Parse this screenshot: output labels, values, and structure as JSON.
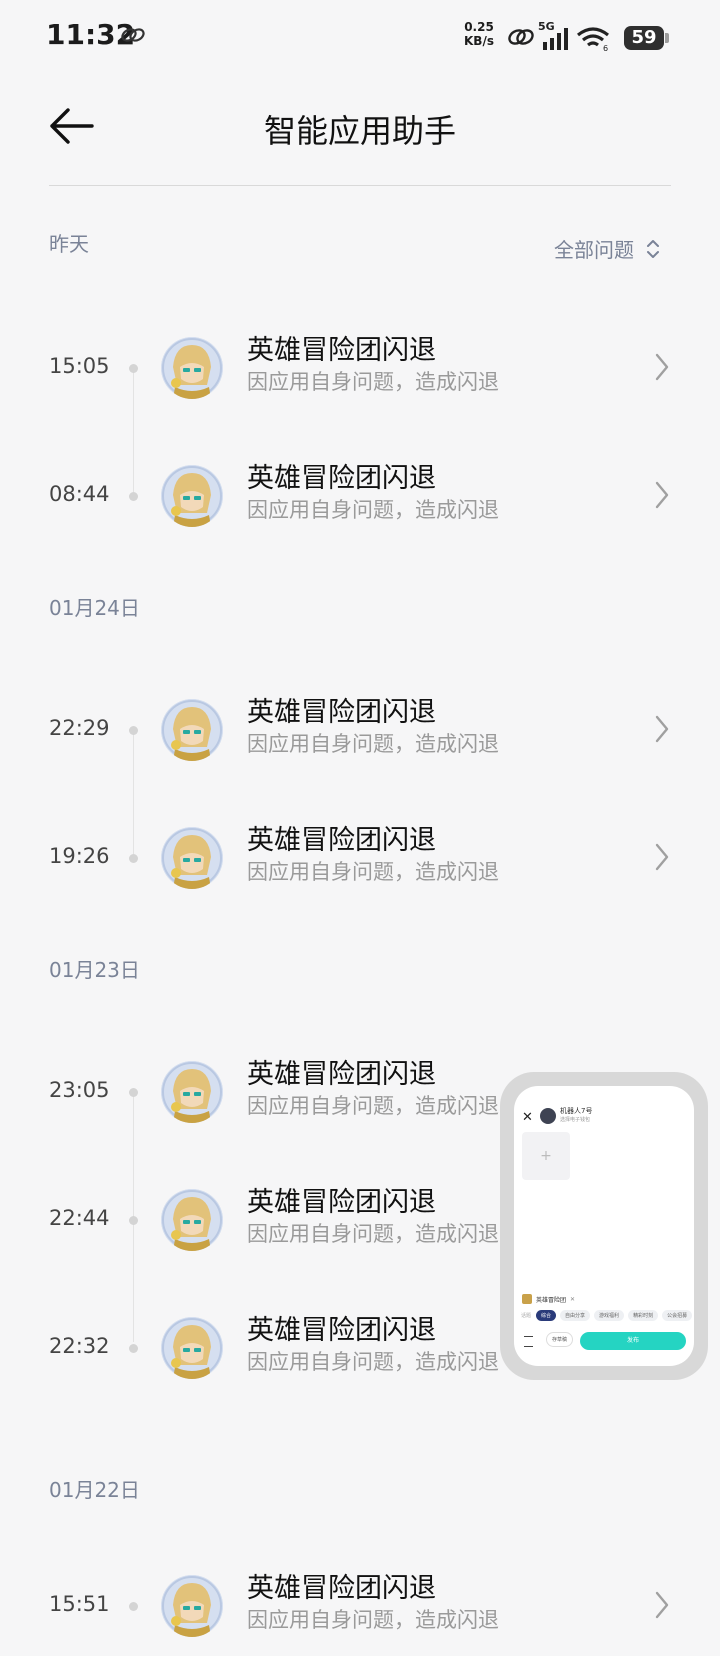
{
  "status_bar": {
    "time": "11:32",
    "net_speed_value": "0.25",
    "net_speed_unit": "KB/s",
    "network_type": "5G",
    "battery": "59"
  },
  "header": {
    "title": "智能应用助手"
  },
  "filter": {
    "label": "全部问题"
  },
  "groups": [
    {
      "label": "昨天",
      "items": [
        {
          "time": "15:05",
          "title": "英雄冒险团闪退",
          "subtitle": "因应用自身问题，造成闪退"
        },
        {
          "time": "08:44",
          "title": "英雄冒险团闪退",
          "subtitle": "因应用自身问题，造成闪退"
        }
      ]
    },
    {
      "label": "01月24日",
      "items": [
        {
          "time": "22:29",
          "title": "英雄冒险团闪退",
          "subtitle": "因应用自身问题，造成闪退"
        },
        {
          "time": "19:26",
          "title": "英雄冒险团闪退",
          "subtitle": "因应用自身问题，造成闪退"
        }
      ]
    },
    {
      "label": "01月23日",
      "items": [
        {
          "time": "23:05",
          "title": "英雄冒险团闪退",
          "subtitle": "因应用自身问题，造成闪退"
        },
        {
          "time": "22:44",
          "title": "英雄冒险团闪退",
          "subtitle": "因应用自身问题，造成闪退"
        },
        {
          "time": "22:32",
          "title": "英雄冒险团闪退",
          "subtitle": "因应用自身问题，造成闪退"
        }
      ]
    },
    {
      "label": "01月22日",
      "items": [
        {
          "time": "15:51",
          "title": "英雄冒险团闪退",
          "subtitle": "因应用自身问题，造成闪退"
        }
      ]
    }
  ],
  "floating_window": {
    "close": "✕",
    "user_name": "机器人7号",
    "user_sub": "选择电子钱包",
    "add": "+",
    "game_tag": "英雄冒险团",
    "tags": [
      "话题",
      "综合",
      "自由分享",
      "游戏福利",
      "精彩时刻",
      "公会招募"
    ],
    "draft": "存草稿",
    "publish": "发布"
  }
}
